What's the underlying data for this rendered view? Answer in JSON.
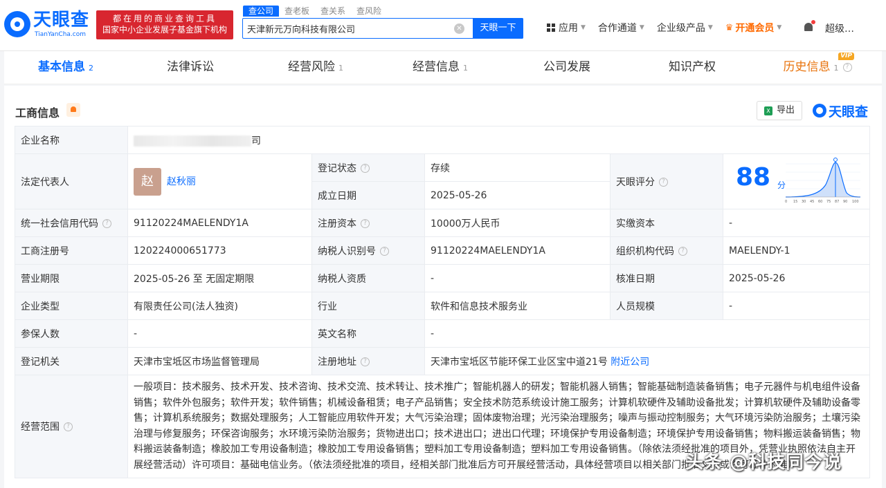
{
  "header": {
    "logo_text": "天眼查",
    "logo_sub": "TianYanCha.com",
    "banner_line1": "都在用的商业查询工具",
    "banner_line2": "国家中小企业发展子基金旗下机构",
    "search_tabs": [
      "查公司",
      "查老板",
      "查关系",
      "查风险"
    ],
    "search_value": "天津新元万向科技有限公司",
    "search_button": "天眼一下",
    "nav": {
      "apps": "应用",
      "partner": "合作通道",
      "enterprise": "企业级产品",
      "vip": "开通会员",
      "user": "超级…"
    }
  },
  "tabs": [
    {
      "label": "基本信息",
      "count": "2"
    },
    {
      "label": "法律诉讼",
      "count": ""
    },
    {
      "label": "经营风险",
      "count": "1"
    },
    {
      "label": "经营信息",
      "count": "1"
    },
    {
      "label": "公司发展",
      "count": ""
    },
    {
      "label": "知识产权",
      "count": ""
    },
    {
      "label": "历史信息",
      "count": "1",
      "badge": "VIP"
    }
  ],
  "section": {
    "title": "工商信息",
    "export_label": "导出",
    "brand": "天眼查"
  },
  "info": {
    "company_name_label": "企业名称",
    "company_name_tail": "司",
    "legal_rep_label": "法定代表人",
    "legal_rep_avatar": "赵",
    "legal_rep_name": "赵秋丽",
    "reg_status_label": "登记状态",
    "reg_status": "存续",
    "found_date_label": "成立日期",
    "found_date": "2025-05-26",
    "score_label": "天眼评分",
    "score": "88",
    "score_unit": "分",
    "score_axis": [
      "0",
      "15",
      "30",
      "45",
      "60",
      "75",
      "87",
      "90",
      "100"
    ],
    "credit_code_label": "统一社会信用代码",
    "credit_code": "91120224MAELENDY1A",
    "reg_capital_label": "注册资本",
    "reg_capital": "10000万人民币",
    "paid_capital_label": "实缴资本",
    "paid_capital": "-",
    "reg_no_label": "工商注册号",
    "reg_no": "120224000651773",
    "taxpayer_id_label": "纳税人识别号",
    "taxpayer_id": "91120224MAELENDY1A",
    "org_code_label": "组织机构代码",
    "org_code": "MAELENDY-1",
    "term_label": "营业期限",
    "term": "2025-05-26 至 无固定期限",
    "taxpayer_qual_label": "纳税人资质",
    "taxpayer_qual": "-",
    "approve_date_label": "核准日期",
    "approve_date": "2025-05-26",
    "type_label": "企业类型",
    "type": "有限责任公司(法人独资)",
    "industry_label": "行业",
    "industry": "软件和信息技术服务业",
    "staff_label": "人员规模",
    "staff": "-",
    "insured_label": "参保人数",
    "insured": "-",
    "english_label": "英文名称",
    "english": "-",
    "authority_label": "登记机关",
    "authority": "天津市宝坻区市场监督管理局",
    "address_label": "注册地址",
    "address": "天津市宝坻区节能环保工业区宝中道21号",
    "nearby": "附近公司",
    "scope_label": "经营范围",
    "scope": "一般项目：技术服务、技术开发、技术咨询、技术交流、技术转让、技术推广；智能机器人的研发；智能机器人销售；智能基础制造装备销售；电子元器件与机电组件设备销售；软件外包服务；软件开发；软件销售；机械设备租赁；电子产品销售；安全技术防范系统设计施工服务；计算机软硬件及辅助设备批发；计算机软硬件及辅助设备零售；计算机系统服务；数据处理服务；人工智能应用软件开发；大气污染治理；固体废物治理；光污染治理服务；噪声与振动控制服务；大气环境污染防治服务；土壤污染治理与修复服务；环保咨询服务；水环境污染防治服务；货物进出口；技术进出口；进出口代理；环境保护专用设备制造；环境保护专用设备销售；物料搬运装备销售；物料搬运装备制造；橡胶加工专用设备制造；橡胶加工专用设备销售；塑料加工专用设备制造；塑料加工专用设备销售。（除依法须经批准的项目外，凭营业执照依法自主开展经营活动）许可项目：基础电信业务。（依法须经批准的项目，经相关部门批准后方可开展经营活动，具体经营项目以相关部门批准文件或许可证件为准）"
  },
  "watermark": "头条 @科技同今说"
}
